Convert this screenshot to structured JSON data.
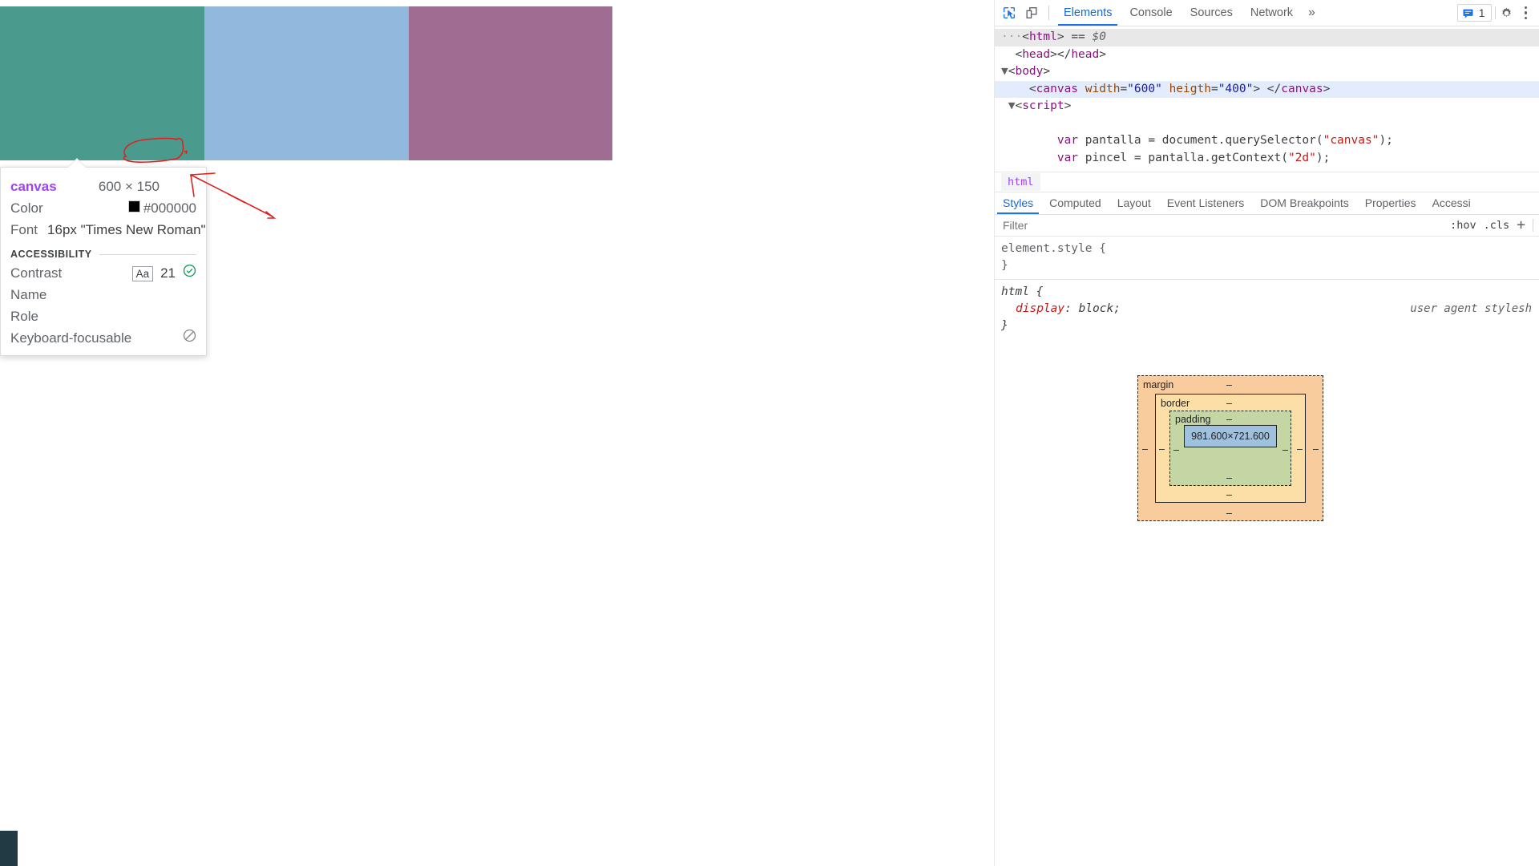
{
  "page": {
    "canvas": {
      "rectangles": [
        {
          "name": "teal-rect",
          "color": "#4a9b8e"
        },
        {
          "name": "blue-rect",
          "color": "#92b9dd"
        },
        {
          "name": "mauve-rect",
          "color": "#a06d92"
        }
      ],
      "dark_bar_color": "#223a44"
    },
    "tooltip": {
      "tag": "canvas",
      "dimensions": "600 × 150",
      "color_label": "Color",
      "color_value": "#000000",
      "color_swatch": "#000000",
      "font_label": "Font",
      "font_value": "16px \"Times New Roman\"",
      "accessibility_heading": "ACCESSIBILITY",
      "contrast_label": "Contrast",
      "contrast_sample": "Aa",
      "contrast_value": "21",
      "name_label": "Name",
      "name_value": "",
      "role_label": "Role",
      "role_value": "",
      "keyboard_label": "Keyboard-focusable",
      "keyboard_value": ""
    },
    "annotation": {
      "color": "#e02020",
      "shape": "ellipse-around-dimensions-with-arrow"
    }
  },
  "devtools": {
    "toolbar": {
      "inspect_icon": "inspect-cursor-icon",
      "device_icon": "device-toolbar-icon",
      "tabs": [
        {
          "label": "Elements",
          "active": true
        },
        {
          "label": "Console",
          "active": false
        },
        {
          "label": "Sources",
          "active": false
        },
        {
          "label": "Network",
          "active": false
        }
      ],
      "more_tabs": "»",
      "message_icon": "message-icon",
      "message_count": "1",
      "settings_icon": "gear-icon",
      "menu_icon": "kebab-menu-icon",
      "accent_color": "#1a73e8"
    },
    "dom": {
      "lines": [
        {
          "indent": 0,
          "selected_root": true,
          "segments": [
            {
              "cls": "dots",
              "text": "···"
            },
            {
              "cls": "punct",
              "text": "<"
            },
            {
              "cls": "tagname",
              "text": "html"
            },
            {
              "cls": "punct",
              "text": "> == "
            },
            {
              "cls": "dollar",
              "text": "$0"
            }
          ]
        },
        {
          "indent": 1,
          "segments": [
            {
              "cls": "punct",
              "text": "<"
            },
            {
              "cls": "tagname",
              "text": "head"
            },
            {
              "cls": "punct",
              "text": "></"
            },
            {
              "cls": "tagname",
              "text": "head"
            },
            {
              "cls": "punct",
              "text": ">"
            }
          ]
        },
        {
          "indent": 0,
          "twisty": "▼",
          "segments": [
            {
              "cls": "punct",
              "text": "<"
            },
            {
              "cls": "tagname",
              "text": "body"
            },
            {
              "cls": "punct",
              "text": ">"
            }
          ]
        },
        {
          "indent": 2,
          "selected": true,
          "segments": [
            {
              "cls": "punct",
              "text": "<"
            },
            {
              "cls": "tagname",
              "text": "canvas"
            },
            {
              "cls": "punct",
              "text": " "
            },
            {
              "cls": "attrname",
              "text": "width"
            },
            {
              "cls": "punct",
              "text": "="
            },
            {
              "cls": "attrval",
              "text": "\"600\""
            },
            {
              "cls": "punct",
              "text": " "
            },
            {
              "cls": "attrname",
              "text": "heigth"
            },
            {
              "cls": "punct",
              "text": "="
            },
            {
              "cls": "attrval",
              "text": "\"400\""
            },
            {
              "cls": "punct",
              "text": "> </"
            },
            {
              "cls": "tagname",
              "text": "canvas"
            },
            {
              "cls": "punct",
              "text": ">"
            }
          ]
        },
        {
          "indent": 1,
          "twisty": "▼",
          "segments": [
            {
              "cls": "punct",
              "text": "<"
            },
            {
              "cls": "tagname",
              "text": "script"
            },
            {
              "cls": "punct",
              "text": ">"
            }
          ]
        },
        {
          "indent": 0,
          "segments": []
        },
        {
          "indent": 4,
          "segments": [
            {
              "cls": "js-kw",
              "text": "var"
            },
            {
              "cls": "js-plain",
              "text": " pantalla = document.querySelector("
            },
            {
              "cls": "js-str",
              "text": "\"canvas\""
            },
            {
              "cls": "js-plain",
              "text": ");"
            }
          ]
        },
        {
          "indent": 4,
          "segments": [
            {
              "cls": "js-kw",
              "text": "var"
            },
            {
              "cls": "js-plain",
              "text": " pincel = pantalla.getContext("
            },
            {
              "cls": "js-str",
              "text": "\"2d\""
            },
            {
              "cls": "js-plain",
              "text": ");"
            }
          ]
        }
      ]
    },
    "breadcrumb": {
      "item": "html"
    },
    "sub_tabs": [
      {
        "label": "Styles",
        "active": true
      },
      {
        "label": "Computed",
        "active": false
      },
      {
        "label": "Layout",
        "active": false
      },
      {
        "label": "Event Listeners",
        "active": false
      },
      {
        "label": "DOM Breakpoints",
        "active": false
      },
      {
        "label": "Properties",
        "active": false
      },
      {
        "label": "Accessi",
        "active": false
      }
    ],
    "filter": {
      "placeholder": "Filter",
      "value": "",
      "hov": ":hov",
      "cls": ".cls",
      "plus": "+"
    },
    "css_rules": [
      {
        "selector": "element.style",
        "selector_style": "element",
        "origin": "",
        "declarations": []
      },
      {
        "selector": "html",
        "selector_style": "html",
        "origin": "user agent stylesh",
        "declarations": [
          {
            "property": "display",
            "value": "block"
          }
        ]
      }
    ],
    "box_model": {
      "margin_label": "margin",
      "border_label": "border",
      "padding_label": "padding",
      "content_size": "981.600×721.600",
      "dash": "–",
      "colors": {
        "margin": "#f9cc9d",
        "border": "#fcdfa6",
        "padding": "#c4d6a4",
        "content": "#9fc1de"
      }
    }
  }
}
